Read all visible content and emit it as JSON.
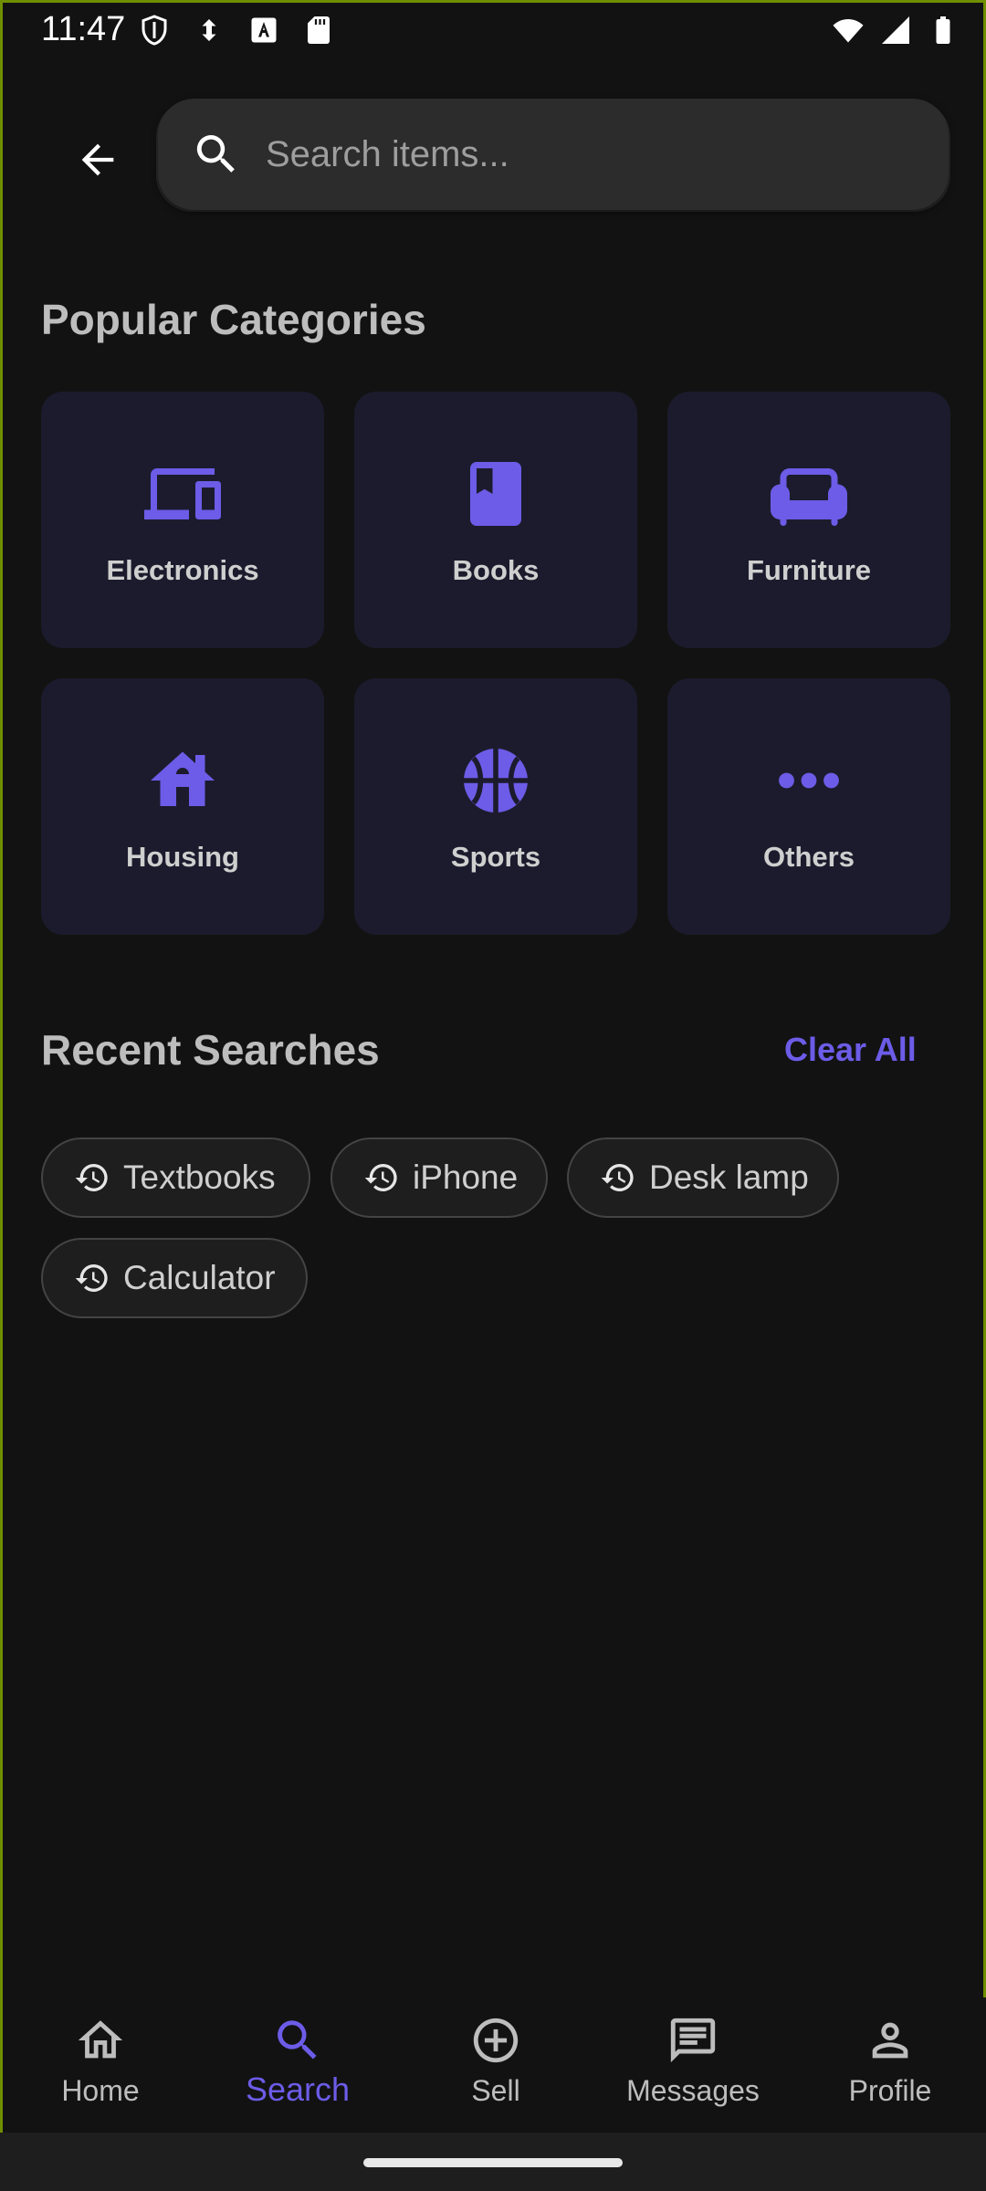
{
  "status_bar": {
    "time": "11:47",
    "left_icons": [
      "shield-icon",
      "data-saver-icon",
      "font-a-icon",
      "sd-card-icon"
    ],
    "right_icons": [
      "wifi-icon",
      "signal-icon",
      "battery-icon"
    ]
  },
  "search": {
    "placeholder": "Search items...",
    "value": ""
  },
  "popular": {
    "title": "Popular Categories",
    "categories": [
      {
        "label": "Electronics",
        "icon": "devices-icon"
      },
      {
        "label": "Books",
        "icon": "book-icon"
      },
      {
        "label": "Furniture",
        "icon": "chair-icon"
      },
      {
        "label": "Housing",
        "icon": "house-icon"
      },
      {
        "label": "Sports",
        "icon": "basketball-icon"
      },
      {
        "label": "Others",
        "icon": "more-horizontal-icon"
      }
    ]
  },
  "recent": {
    "title": "Recent Searches",
    "clear_label": "Clear All",
    "items": [
      "Textbooks",
      "iPhone",
      "Desk lamp",
      "Calculator"
    ]
  },
  "nav": {
    "items": [
      {
        "label": "Home",
        "icon": "home-icon",
        "active": false
      },
      {
        "label": "Search",
        "icon": "search-icon",
        "active": true
      },
      {
        "label": "Sell",
        "icon": "add-circle-icon",
        "active": false
      },
      {
        "label": "Messages",
        "icon": "message-icon",
        "active": false
      },
      {
        "label": "Profile",
        "icon": "person-icon",
        "active": false
      }
    ]
  },
  "colors": {
    "accent": "#6c5ce7",
    "background": "#121212",
    "tile": "#1c1b2d"
  }
}
